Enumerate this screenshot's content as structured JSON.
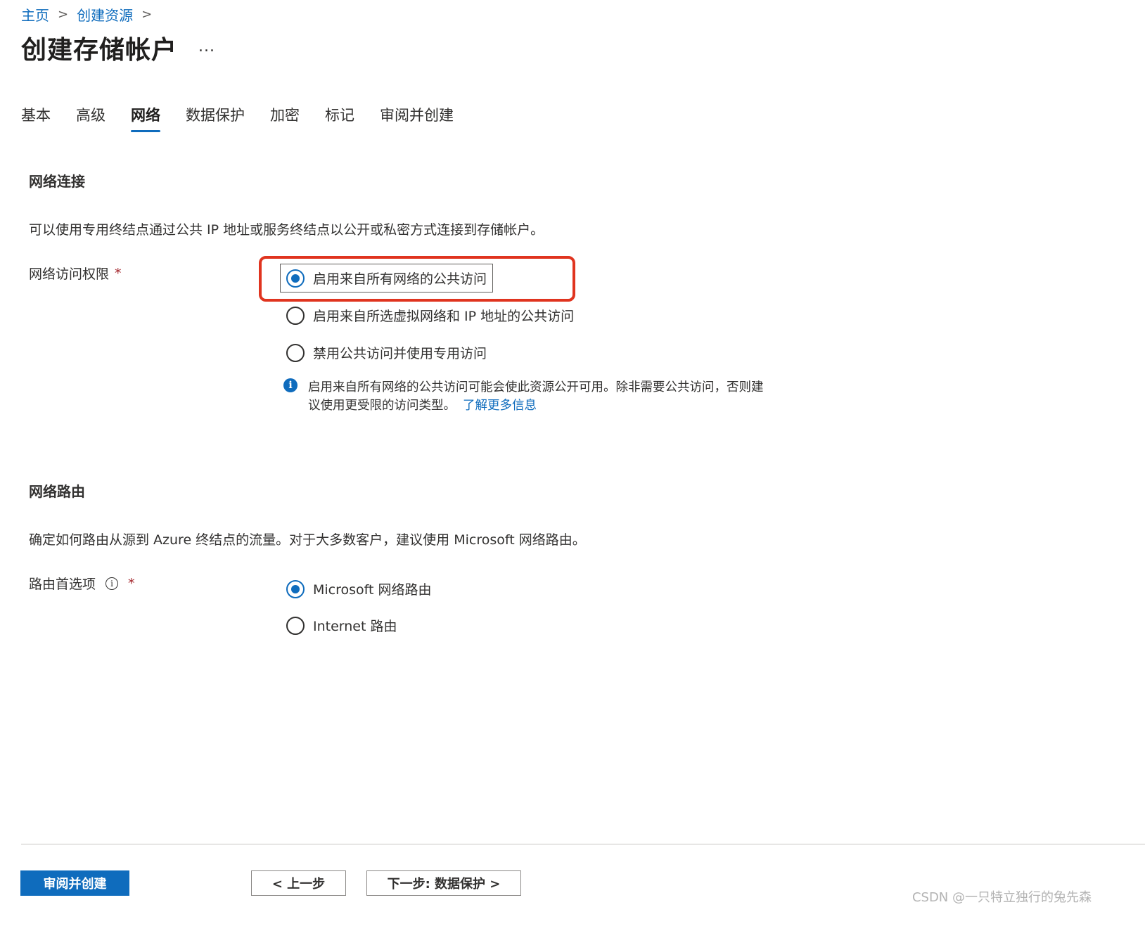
{
  "breadcrumb": {
    "items": [
      "主页",
      "创建资源"
    ],
    "separator": ">"
  },
  "page": {
    "title": "创建存储帐户",
    "more_label": "..."
  },
  "tabs": [
    {
      "label": "基本",
      "active": false
    },
    {
      "label": "高级",
      "active": false
    },
    {
      "label": "网络",
      "active": true
    },
    {
      "label": "数据保护",
      "active": false
    },
    {
      "label": "加密",
      "active": false
    },
    {
      "label": "标记",
      "active": false
    },
    {
      "label": "审阅并创建",
      "active": false
    }
  ],
  "network_connectivity": {
    "title": "网络连接",
    "description": "可以使用专用终结点通过公共 IP 地址或服务终结点以公开或私密方式连接到存储帐户。",
    "access_label": "网络访问权限",
    "required_mark": "*",
    "options": [
      {
        "label": "启用来自所有网络的公共访问",
        "selected": true
      },
      {
        "label": "启用来自所选虚拟网络和 IP 地址的公共访问",
        "selected": false
      },
      {
        "label": "禁用公共访问并使用专用访问",
        "selected": false
      }
    ],
    "info_icon": "i",
    "info_line1": "启用来自所有网络的公共访问可能会使此资源公开可用。除非需要公共访问，否则建",
    "info_line2": "议使用更受限的访问类型。",
    "info_link": "了解更多信息"
  },
  "network_routing": {
    "title": "网络路由",
    "description": "确定如何路由从源到 Azure 终结点的流量。对于大多数客户，建议使用 Microsoft 网络路由。",
    "routing_label": "路由首选项",
    "tooltip_icon": "i",
    "required_mark": "*",
    "options": [
      {
        "label": "Microsoft 网络路由",
        "selected": true
      },
      {
        "label": "Internet 路由",
        "selected": false
      }
    ]
  },
  "footer": {
    "review_create": "审阅并创建",
    "previous": "< 上一步",
    "next": "下一步: 数据保护 >"
  },
  "watermark": "CSDN @一只特立独行的兔先森",
  "colors": {
    "accent": "#0f6cbd",
    "highlight": "#e0341f",
    "required": "#a4262c"
  }
}
